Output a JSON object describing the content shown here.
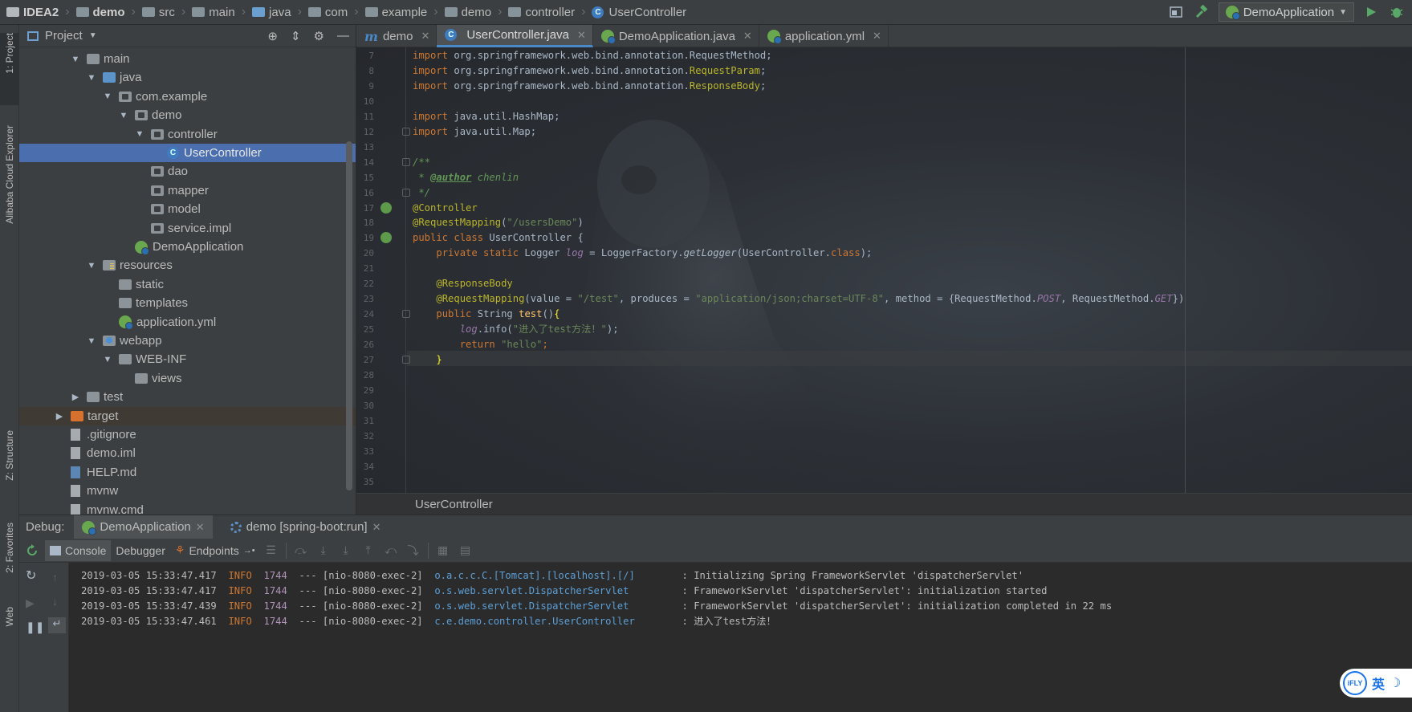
{
  "navbar": {
    "crumbs": [
      "IDEA2",
      "demo",
      "src",
      "main",
      "java",
      "com",
      "example",
      "demo",
      "controller",
      "UserController"
    ],
    "run_config": "DemoApplication"
  },
  "left_strip": {
    "tabs": [
      "1: Project",
      "Alibaba Cloud Explorer",
      "Z: Structure",
      "2: Favorites",
      "Web"
    ]
  },
  "project": {
    "title": "Project",
    "tree": [
      {
        "label": "main",
        "depth": 1,
        "arrow": "down",
        "icon": "folder-grey"
      },
      {
        "label": "java",
        "depth": 2,
        "arrow": "down",
        "icon": "folder-blue"
      },
      {
        "label": "com.example",
        "depth": 3,
        "arrow": "down",
        "icon": "package"
      },
      {
        "label": "demo",
        "depth": 4,
        "arrow": "down",
        "icon": "package"
      },
      {
        "label": "controller",
        "depth": 5,
        "arrow": "down",
        "icon": "package"
      },
      {
        "label": "UserController",
        "depth": 6,
        "arrow": "",
        "icon": "class",
        "selected": true
      },
      {
        "label": "dao",
        "depth": 5,
        "arrow": "",
        "icon": "package"
      },
      {
        "label": "mapper",
        "depth": 5,
        "arrow": "",
        "icon": "package"
      },
      {
        "label": "model",
        "depth": 5,
        "arrow": "",
        "icon": "package"
      },
      {
        "label": "service.impl",
        "depth": 5,
        "arrow": "",
        "icon": "package"
      },
      {
        "label": "DemoApplication",
        "depth": 4,
        "arrow": "",
        "icon": "spring-class"
      },
      {
        "label": "resources",
        "depth": 2,
        "arrow": "down",
        "icon": "folder-res"
      },
      {
        "label": "static",
        "depth": 3,
        "arrow": "",
        "icon": "folder-grey"
      },
      {
        "label": "templates",
        "depth": 3,
        "arrow": "",
        "icon": "folder-grey"
      },
      {
        "label": "application.yml",
        "depth": 3,
        "arrow": "",
        "icon": "spring-yml"
      },
      {
        "label": "webapp",
        "depth": 2,
        "arrow": "down",
        "icon": "folder-web"
      },
      {
        "label": "WEB-INF",
        "depth": 3,
        "arrow": "down",
        "icon": "folder-grey"
      },
      {
        "label": "views",
        "depth": 4,
        "arrow": "",
        "icon": "folder-grey"
      },
      {
        "label": "test",
        "depth": 1,
        "arrow": "right",
        "icon": "folder-grey"
      },
      {
        "label": "target",
        "depth": 0,
        "arrow": "right",
        "icon": "folder-orange",
        "highlight": true
      },
      {
        "label": ".gitignore",
        "depth": 0,
        "arrow": "",
        "icon": "file"
      },
      {
        "label": "demo.iml",
        "depth": 0,
        "arrow": "",
        "icon": "file-iml"
      },
      {
        "label": "HELP.md",
        "depth": 0,
        "arrow": "",
        "icon": "file-md"
      },
      {
        "label": "mvnw",
        "depth": 0,
        "arrow": "",
        "icon": "file"
      },
      {
        "label": "mvnw.cmd",
        "depth": 0,
        "arrow": "",
        "icon": "file"
      }
    ]
  },
  "editor_tabs": [
    {
      "label": "demo",
      "icon": "m",
      "active": false
    },
    {
      "label": "UserController.java",
      "icon": "class",
      "active": true
    },
    {
      "label": "DemoApplication.java",
      "icon": "spring-class",
      "active": false
    },
    {
      "label": "application.yml",
      "icon": "spring-yml",
      "active": false
    }
  ],
  "editor": {
    "line_numbers": [
      "7",
      "8",
      "9",
      "10",
      "11",
      "12",
      "13",
      "14",
      "15",
      "16",
      "17",
      "18",
      "19",
      "20",
      "21",
      "22",
      "23",
      "24",
      "25",
      "26",
      "27",
      "28",
      "29",
      "30",
      "31",
      "32",
      "33",
      "34",
      "35"
    ],
    "lines": [
      [
        [
          "kw",
          "import "
        ],
        [
          "",
          "org.springframework.web.bind.annotation.RequestMethod;"
        ]
      ],
      [
        [
          "kw",
          "import "
        ],
        [
          "",
          "org.springframework.web.bind.annotation."
        ],
        [
          "yl",
          "RequestParam"
        ],
        [
          "",
          ";"
        ]
      ],
      [
        [
          "kw",
          "import "
        ],
        [
          "",
          "org.springframework.web.bind.annotation."
        ],
        [
          "yl",
          "ResponseBody"
        ],
        [
          "",
          ";"
        ]
      ],
      [],
      [
        [
          "kw",
          "import "
        ],
        [
          "",
          "java.util.HashMap;"
        ]
      ],
      [
        [
          "kw",
          "import "
        ],
        [
          "",
          "java.util.Map;"
        ]
      ],
      [],
      [
        [
          "cm",
          "/**"
        ]
      ],
      [
        [
          "cm",
          " * "
        ],
        [
          "cmtag",
          "@author"
        ],
        [
          "cm",
          " chenlin"
        ]
      ],
      [
        [
          "cm",
          " */"
        ]
      ],
      [
        [
          "an",
          "@Controller"
        ]
      ],
      [
        [
          "an",
          "@RequestMapping"
        ],
        [
          "",
          "("
        ],
        [
          "st",
          "\"/usersDemo\""
        ],
        [
          "",
          ")"
        ]
      ],
      [
        [
          "kw",
          "public class "
        ],
        [
          "",
          "UserController {"
        ]
      ],
      [
        [
          "",
          "    "
        ],
        [
          "kw",
          "private static "
        ],
        [
          "",
          "Logger "
        ],
        [
          "it",
          "log"
        ],
        [
          "",
          " = LoggerFactory."
        ],
        [
          "sf",
          "getLogger"
        ],
        [
          "",
          "(UserController."
        ],
        [
          "kw",
          "class"
        ],
        [
          "",
          ");"
        ]
      ],
      [],
      [
        [
          "",
          "    "
        ],
        [
          "an",
          "@ResponseBody"
        ]
      ],
      [
        [
          "",
          "    "
        ],
        [
          "an",
          "@RequestMapping"
        ],
        [
          "",
          "(value = "
        ],
        [
          "st",
          "\"/test\""
        ],
        [
          "",
          ", produces = "
        ],
        [
          "st",
          "\"application/json;charset=UTF-8\""
        ],
        [
          "",
          ", method = {RequestMethod."
        ],
        [
          "pt",
          "POST"
        ],
        [
          "",
          ", RequestMethod."
        ],
        [
          "pt",
          "GET"
        ],
        [
          "",
          "})"
        ]
      ],
      [
        [
          "",
          "    "
        ],
        [
          "kw",
          "public "
        ],
        [
          "",
          "String "
        ],
        [
          "fn",
          "test"
        ],
        [
          "",
          "()"
        ],
        [
          "brace",
          "{"
        ]
      ],
      [
        [
          "",
          "        "
        ],
        [
          "it",
          "log"
        ],
        [
          "",
          ".info("
        ],
        [
          "st",
          "\"进入了test方法！\""
        ],
        [
          "",
          ");"
        ]
      ],
      [
        [
          "",
          "        "
        ],
        [
          "kw",
          "return "
        ],
        [
          "st",
          "\"hello\""
        ],
        [
          "kw",
          ";"
        ]
      ],
      [
        [
          "",
          "    "
        ],
        [
          "brace",
          "}"
        ]
      ],
      [],
      [],
      [],
      [],
      [],
      [],
      [],
      []
    ],
    "breadcrumb": "UserController"
  },
  "debug": {
    "label": "Debug:",
    "tabs": [
      "DemoApplication",
      "demo [spring-boot:run]"
    ],
    "toolbar": [
      "Console",
      "Debugger",
      "Endpoints"
    ],
    "log": [
      {
        "ts": "2019-03-05 15:33:47.417",
        "level": "INFO",
        "pid": "1744",
        "thread": "--- [nio-8080-exec-2]",
        "logger": "o.a.c.c.C.[Tomcat].[localhost].[/]      ",
        "msg": ": Initializing Spring FrameworkServlet 'dispatcherServlet'"
      },
      {
        "ts": "2019-03-05 15:33:47.417",
        "level": "INFO",
        "pid": "1744",
        "thread": "--- [nio-8080-exec-2]",
        "logger": "o.s.web.servlet.DispatcherServlet       ",
        "msg": ": FrameworkServlet 'dispatcherServlet': initialization started"
      },
      {
        "ts": "2019-03-05 15:33:47.439",
        "level": "INFO",
        "pid": "1744",
        "thread": "--- [nio-8080-exec-2]",
        "logger": "o.s.web.servlet.DispatcherServlet       ",
        "msg": ": FrameworkServlet 'dispatcherServlet': initialization completed in 22 ms"
      },
      {
        "ts": "2019-03-05 15:33:47.461",
        "level": "INFO",
        "pid": "1744",
        "thread": "--- [nio-8080-exec-2]",
        "logger": "c.e.demo.controller.UserController      ",
        "msg": ": 进入了test方法！"
      }
    ]
  },
  "ime": {
    "brand": "iFLY",
    "lang": "英"
  }
}
